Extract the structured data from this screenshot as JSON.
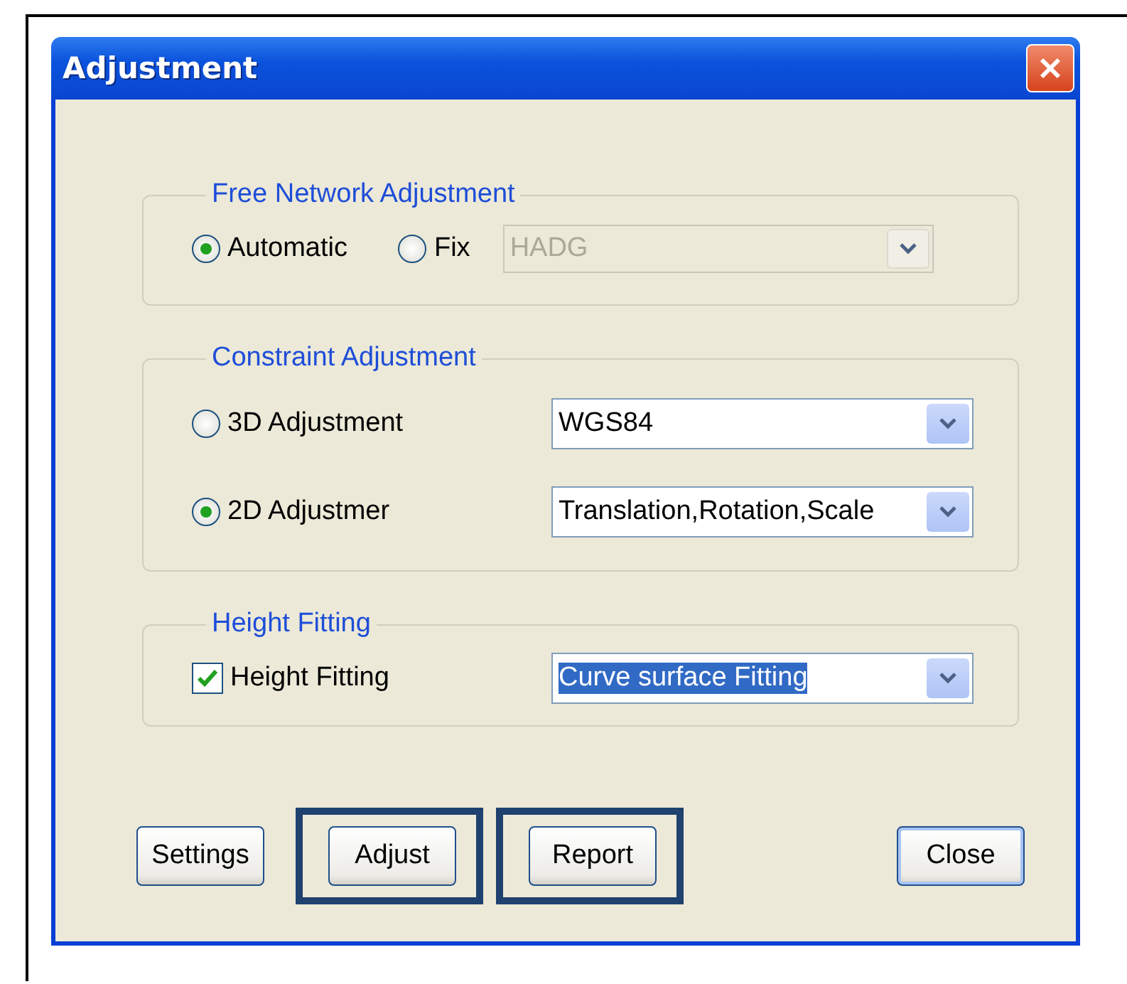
{
  "window": {
    "title": "Adjustment"
  },
  "free_network": {
    "title": "Free Network Adjustment",
    "options": [
      {
        "label": "Automatic",
        "selected": true
      },
      {
        "label": "Fix",
        "selected": false
      }
    ],
    "dropdown": {
      "value": "HADG",
      "disabled": true
    }
  },
  "constraint": {
    "title": "Constraint Adjustment",
    "rows": [
      {
        "label": "3D Adjustment",
        "selected": false,
        "dropdown": {
          "value": "WGS84"
        }
      },
      {
        "label": "2D Adjustmer",
        "selected": true,
        "dropdown": {
          "value": "Translation,Rotation,Scale"
        }
      }
    ]
  },
  "height_fitting": {
    "title": "Height Fitting",
    "checkbox": {
      "label": "Height Fitting",
      "checked": true
    },
    "dropdown": {
      "value": "Curve surface Fitting",
      "text_selected": true
    }
  },
  "buttons": [
    {
      "label": "Settings",
      "highlighted": false,
      "default": false
    },
    {
      "label": "Adjust",
      "highlighted": true,
      "default": false
    },
    {
      "label": "Report",
      "highlighted": true,
      "default": false
    },
    {
      "label": "Close",
      "highlighted": false,
      "default": true
    }
  ]
}
